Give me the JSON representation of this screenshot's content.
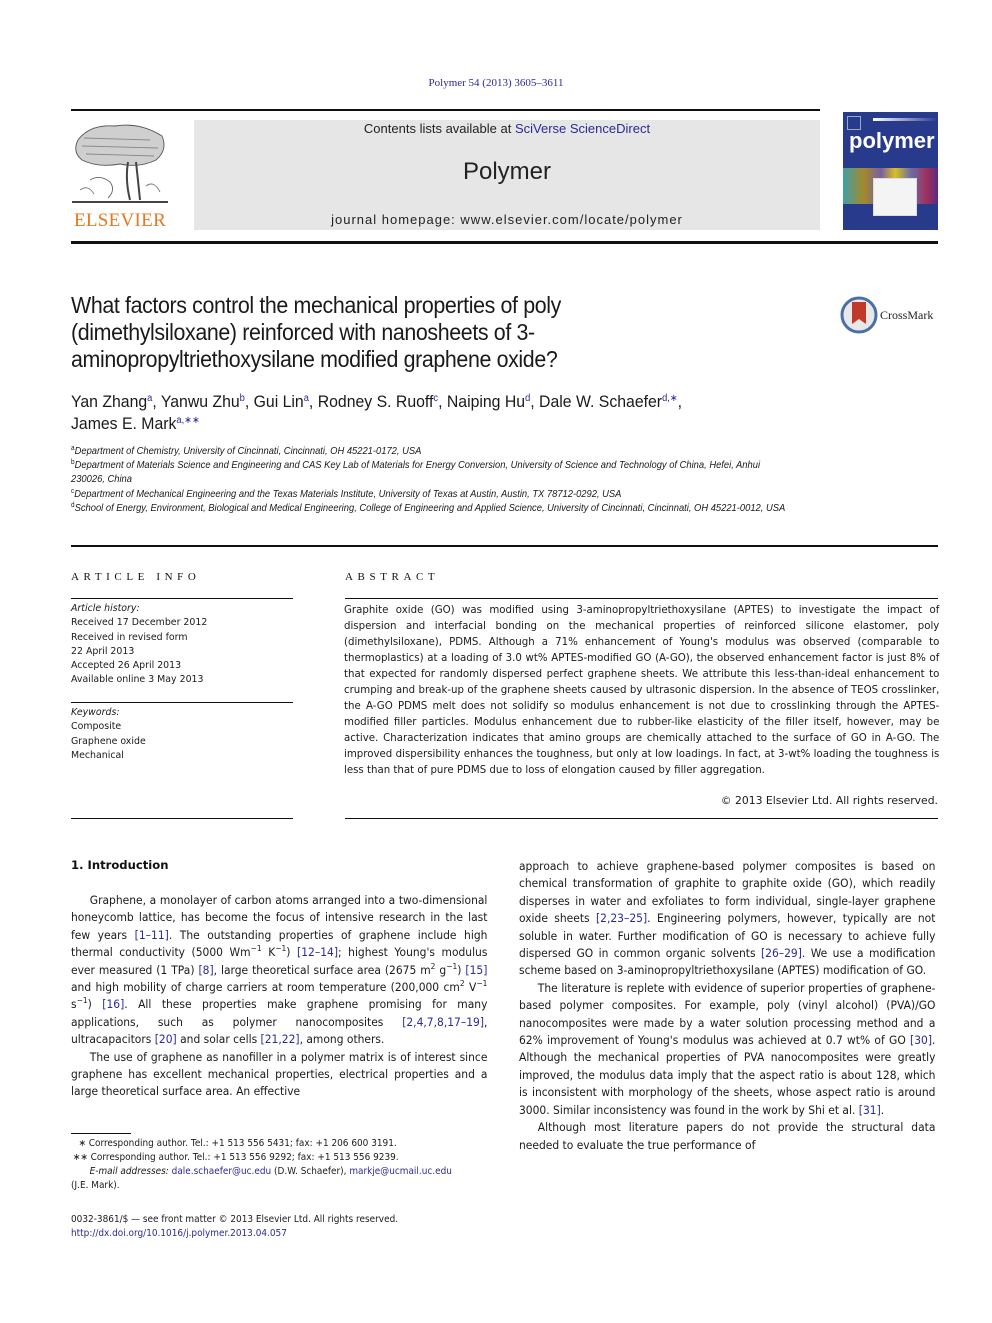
{
  "header": {
    "citation": "Polymer 54 (2013) 3605–3611",
    "contents_prefix": "Contents lists available at ",
    "contents_link": "SciVerse ScienceDirect",
    "journal_name": "Polymer",
    "homepage_prefix": "journal homepage: ",
    "homepage_url": "www.elsevier.com/locate/polymer",
    "publisher_logo_text": "ELSEVIER",
    "cover_title": "polymer",
    "crossmark_label": "CrossMark",
    "colors": {
      "elsevier_orange": "#e87722",
      "cover_blue": "#283a8c",
      "link_blue": "#2a2a9a",
      "masthead_gray": "#e6e6e6"
    }
  },
  "article": {
    "title_lines": [
      "What factors control the mechanical properties of poly",
      "(dimethylsiloxane) reinforced with nanosheets of 3-",
      "aminopropyltriethoxysilane modified graphene oxide?"
    ],
    "authors": [
      {
        "name": "Yan Zhang",
        "sup": "a",
        "sep": ", "
      },
      {
        "name": "Yanwu Zhu",
        "sup": "b",
        "sep": ", "
      },
      {
        "name": "Gui Lin",
        "sup": "a",
        "sep": ", "
      },
      {
        "name": "Rodney S. Ruoff",
        "sup": "c",
        "sep": ", "
      },
      {
        "name": "Naiping Hu",
        "sup": "d",
        "sep": ", "
      },
      {
        "name": "Dale W. Schaefer",
        "sup": "d,∗",
        "sep": ","
      },
      {
        "name": "James E. Mark",
        "sup": "a,∗∗",
        "sep": ""
      }
    ],
    "affiliations": [
      {
        "sup": "a",
        "text": "Department of Chemistry, University of Cincinnati, Cincinnati, OH 45221-0172, USA"
      },
      {
        "sup": "b",
        "text": "Department of Materials Science and Engineering and CAS Key Lab of Materials for Energy Conversion, University of Science and Technology of China, Hefei, Anhui 230026, China"
      },
      {
        "sup": "c",
        "text": "Department of Mechanical Engineering and the Texas Materials Institute, University of Texas at Austin, Austin, TX 78712-0292, USA"
      },
      {
        "sup": "d",
        "text": "School of Energy, Environment, Biological and Medical Engineering, College of Engineering and Applied Science, University of Cincinnati, Cincinnati, OH 45221-0012, USA"
      }
    ]
  },
  "article_info": {
    "heading": "ARTICLE INFO",
    "history_label": "Article history:",
    "history": [
      "Received 17 December 2012",
      "Received in revised form",
      "22 April 2013",
      "Accepted 26 April 2013",
      "Available online 3 May 2013"
    ],
    "keywords_label": "Keywords:",
    "keywords": [
      "Composite",
      "Graphene oxide",
      "Mechanical"
    ]
  },
  "abstract": {
    "heading": "ABSTRACT",
    "text": "Graphite oxide (GO) was modified using 3-aminopropyltriethoxysilane (APTES) to investigate the impact of dispersion and interfacial bonding on the mechanical properties of reinforced silicone elastomer, poly (dimethylsiloxane), PDMS. Although a 71% enhancement of Young's modulus was observed (comparable to thermoplastics) at a loading of 3.0 wt% APTES-modified GO (A-GO), the observed enhancement factor is just 8% of that expected for randomly dispersed perfect graphene sheets. We attribute this less-than-ideal enhancement to crumping and break-up of the graphene sheets caused by ultrasonic dispersion. In the absence of TEOS crosslinker, the A-GO PDMS melt does not solidify so modulus enhancement is not due to crosslinking through the APTES-modified filler particles. Modulus enhancement due to rubber-like elasticity of the filler itself, however, may be active. Characterization indicates that amino groups are chemically attached to the surface of GO in A-GO. The improved dispersibility enhances the toughness, but only at low loadings. In fact, at 3-wt% loading the toughness is less than that of pure PDMS due to loss of elongation caused by filler aggregation.",
    "copyright": "© 2013 Elsevier Ltd. All rights reserved."
  },
  "introduction": {
    "heading": "1.  Introduction",
    "p1": [
      {
        "t": "Graphene, a monolayer of carbon atoms arranged into a two-dimensional honeycomb lattice, has become the focus of intensive research in the last few years "
      },
      {
        "ref": "[1–11]"
      },
      {
        "t": ". The outstanding properties of graphene include high thermal conductivity (5000 Wm"
      },
      {
        "sup": "−1"
      },
      {
        "t": " K"
      },
      {
        "sup": "−1"
      },
      {
        "t": ") "
      },
      {
        "ref": "[12–14]"
      },
      {
        "t": "; highest Young's modulus ever measured (1 TPa) "
      },
      {
        "ref": "[8]"
      },
      {
        "t": ", large theoretical surface area (2675 m"
      },
      {
        "sup": "2"
      },
      {
        "t": " g"
      },
      {
        "sup": "−1"
      },
      {
        "t": ") "
      },
      {
        "ref": "[15]"
      },
      {
        "t": " and high mobility of charge carriers at room temperature (200,000 cm"
      },
      {
        "sup": "2"
      },
      {
        "t": " V"
      },
      {
        "sup": "−1"
      },
      {
        "t": " s"
      },
      {
        "sup": "−1"
      },
      {
        "t": ") "
      },
      {
        "ref": "[16]"
      },
      {
        "t": ". All these properties make graphene promising for many applications, such as polymer nanocomposites "
      },
      {
        "ref": "[2,4,7,8,17–19]"
      },
      {
        "t": ", ultracapacitors "
      },
      {
        "ref": "[20]"
      },
      {
        "t": " and solar cells "
      },
      {
        "ref": "[21,22]"
      },
      {
        "t": ", among others."
      }
    ],
    "p2_left": "The use of graphene as nanofiller in a polymer matrix is of interest since graphene has excellent mechanical properties, electrical properties and a large theoretical surface area. An effective",
    "p2_right": [
      {
        "t": "approach to achieve graphene-based polymer composites is based on chemical transformation of graphite to graphite oxide (GO), which readily disperses in water and exfoliates to form individual, single-layer graphene oxide sheets "
      },
      {
        "ref": "[2,23–25]"
      },
      {
        "t": ". Engineering polymers, however, typically are not soluble in water. Further modification of GO is necessary to achieve fully dispersed GO in common organic solvents "
      },
      {
        "ref": "[26–29]"
      },
      {
        "t": ". We use a modification scheme based on 3-aminopropyltriethoxysilane (APTES) modification of GO."
      }
    ],
    "p3": [
      {
        "t": "The literature is replete with evidence of superior properties of graphene-based polymer composites. For example, poly (vinyl alcohol) (PVA)/GO nanocomposites were made by a water solution processing method and a 62% improvement of Young's modulus was achieved at 0.7 wt% of GO "
      },
      {
        "ref": "[30]"
      },
      {
        "t": ". Although the mechanical properties of PVA nanocomposites were greatly improved, the modulus data imply that the aspect ratio is about 128, which is inconsistent with morphology of the sheets, whose aspect ratio is around 3000. Similar inconsistency was found in the work by Shi et al. "
      },
      {
        "ref": "[31]"
      },
      {
        "t": "."
      }
    ],
    "p4": "Although most literature papers do not provide the structural data needed to evaluate the true performance of"
  },
  "footnotes": {
    "corr1": "∗  Corresponding author. Tel.: +1 513 556 5431; fax: +1 206 600 3191.",
    "corr2": "∗∗  Corresponding author. Tel.: +1 513 556 9292; fax: +1 513 556 9239.",
    "email_label": "E-mail addresses:",
    "email1": "dale.schaefer@uc.edu",
    "email1_owner": " (D.W. Schaefer), ",
    "email2": "markje@ucmail.uc.edu",
    "email2_owner": "(J.E. Mark)."
  },
  "footer": {
    "issn": "0032-3861/$ — see front matter © 2013 Elsevier Ltd. All rights reserved.",
    "doi": "http://dx.doi.org/10.1016/j.polymer.2013.04.057"
  }
}
